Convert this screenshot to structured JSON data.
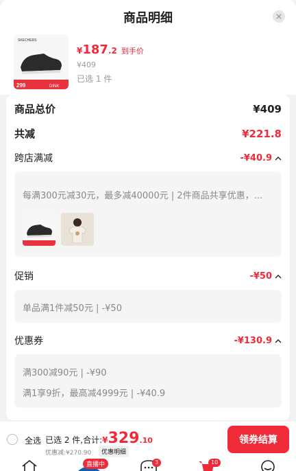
{
  "header": {
    "title": "商品明细"
  },
  "product": {
    "price_currency": "¥",
    "price_int": "187",
    "price_dec": ".2",
    "price_tag": "到手价",
    "original_price": "¥409",
    "selected_count": "已选 1 件",
    "thumb_brand": "SKECHERS",
    "thumb_price": "299",
    "thumb_badge": "DINK"
  },
  "summary": {
    "total_label": "商品总价",
    "total_value": "¥409",
    "reduce_label": "共减",
    "reduce_value": "¥221.8",
    "cross_label": "跨店满减",
    "cross_value": "-¥40.9",
    "cross_desc": "每满300元减30元，最多减40000元 | 2件商品共享优惠，...",
    "promo_label": "促销",
    "promo_value": "-¥50",
    "promo_desc": "单品满1件减50元 | -¥50",
    "coupon_label": "优惠券",
    "coupon_value": "-¥130.9",
    "coupon_desc_1": "满300减90元 | -¥90",
    "coupon_desc_2": "满1享9折，最高减4999元 | -¥40.9"
  },
  "bottom_bar": {
    "select_all": "全选",
    "summary_prefix": "已选 2 件,合计:",
    "total_currency": "¥",
    "total_int": "329",
    "total_dec": ".10",
    "discount_text": "优惠减:¥270.90",
    "detail_button": "优惠明细",
    "checkout_button": "领券结算",
    "live_badge": "直播中",
    "msg_count": "3",
    "cart_count": "10"
  },
  "colors": {
    "accent": "#ef2b3a",
    "panel": "#f5f5f5"
  }
}
